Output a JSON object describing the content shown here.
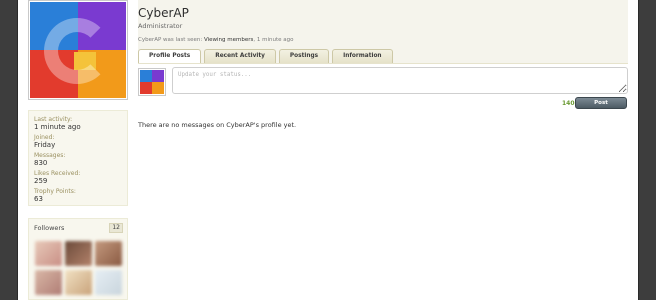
{
  "sidebar": {
    "stats": [
      {
        "label": "Last activity:",
        "value": "1 minute ago"
      },
      {
        "label": "Joined:",
        "value": "Friday"
      },
      {
        "label": "Messages:",
        "value": "830"
      },
      {
        "label": "Likes Received:",
        "value": "259"
      },
      {
        "label": "Trophy Points:",
        "value": "63"
      }
    ],
    "followers": {
      "title": "Followers",
      "count": "12"
    }
  },
  "profile": {
    "username": "CyberAP",
    "title": "Administrator",
    "last_seen": {
      "prefix": "CyberAP was last seen:",
      "activity": "Viewing members",
      "separator": ",",
      "time": "1 minute ago"
    }
  },
  "tabs": [
    {
      "label": "Profile Posts",
      "active": true
    },
    {
      "label": "Recent Activity",
      "active": false
    },
    {
      "label": "Postings",
      "active": false
    },
    {
      "label": "Information",
      "active": false
    }
  ],
  "status": {
    "placeholder": "Update your status...",
    "char_count": "140",
    "post_label": "Post"
  },
  "messages": {
    "empty_text": "There are no messages on CyberAP's profile yet."
  },
  "colors": {
    "accent_green": "#6a9a32",
    "avatar_blue": "#2a7fd8",
    "avatar_purple": "#7a3ad0",
    "avatar_red": "#e23b2d",
    "avatar_orange": "#f29a1a"
  }
}
